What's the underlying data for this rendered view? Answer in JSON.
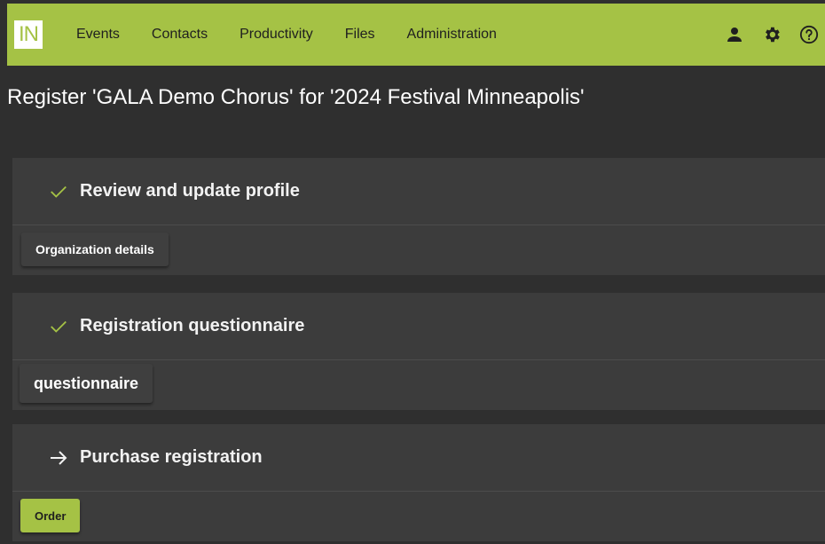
{
  "app": {
    "logo_text": "IN",
    "brand_color": "#a5c245"
  },
  "nav": {
    "items": [
      {
        "label": "Events"
      },
      {
        "label": "Contacts"
      },
      {
        "label": "Productivity"
      },
      {
        "label": "Files"
      },
      {
        "label": "Administration"
      }
    ],
    "icons": [
      "user-icon",
      "gear-icon",
      "help-icon"
    ]
  },
  "page": {
    "title": "Register 'GALA Demo Chorus' for '2024 Festival Minneapolis'"
  },
  "steps": [
    {
      "status": "check-icon",
      "title": "Review and update profile",
      "button_label": "Organization details"
    },
    {
      "status": "check-icon",
      "title": "Registration questionnaire",
      "button_label": "questionnaire"
    },
    {
      "status": "arrow-right-icon",
      "title": "Purchase registration",
      "button_label": "Order"
    }
  ]
}
